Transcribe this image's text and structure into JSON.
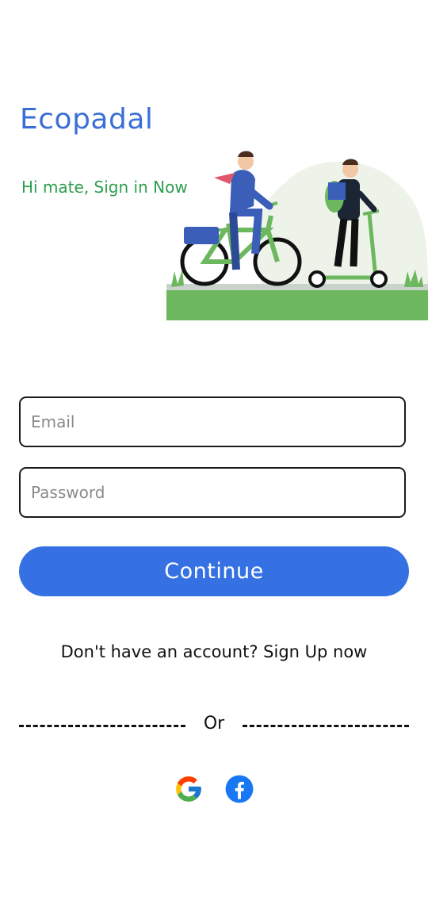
{
  "app": {
    "brand": "Ecopadal",
    "greeting": "Hi mate, Sign in Now"
  },
  "form": {
    "email_placeholder": "Email",
    "password_placeholder": "Password",
    "continue_label": "Continue"
  },
  "signup": {
    "prompt": "Don't have an account? ",
    "link": "Sign Up now"
  },
  "divider": {
    "label": "Or"
  },
  "social": [
    "google-icon",
    "facebook-icon"
  ],
  "colors": {
    "brand": "#3b6fd6",
    "greeting": "#2e9e4f",
    "button": "#3571e3"
  }
}
